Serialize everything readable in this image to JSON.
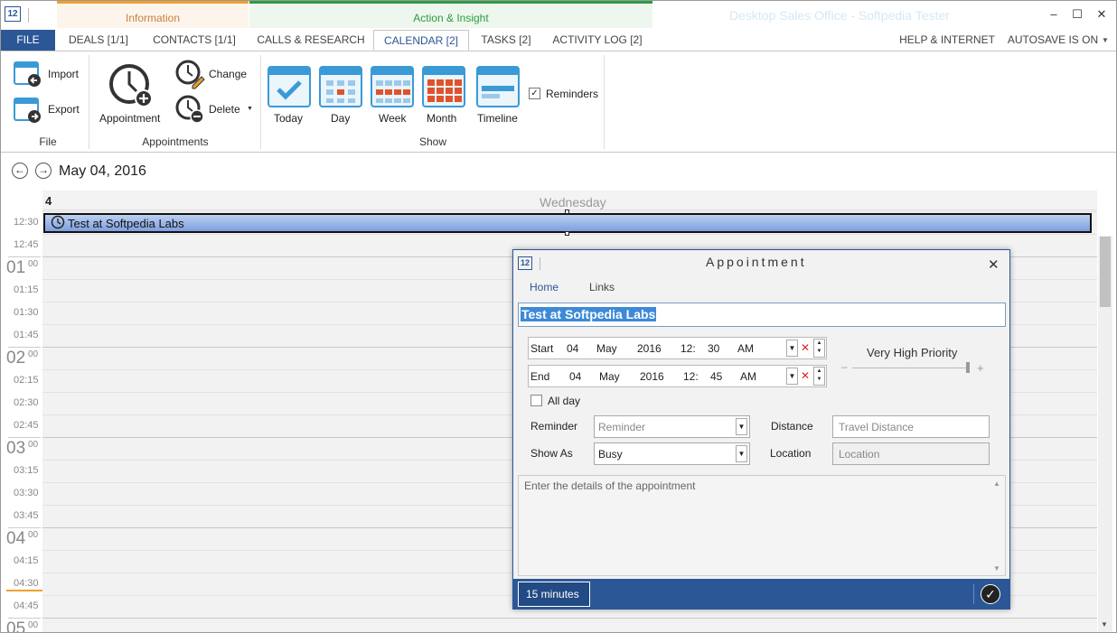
{
  "window": {
    "title": "Desktop Sales Office - Softpedia Tester",
    "logo": "12",
    "controls": {
      "minimize": "–",
      "maximize": "☐",
      "close": "✕"
    }
  },
  "ribbon_groups": {
    "information": "Information",
    "action": "Action & Insight"
  },
  "tabs": {
    "file": "FILE",
    "deals": "DEALS [1/1]",
    "contacts": "CONTACTS [1/1]",
    "calls": "CALLS & RESEARCH",
    "calendar": "CALENDAR [2]",
    "tasks": "TASKS [2]",
    "activity": "ACTIVITY LOG [2]",
    "help": "HELP & INTERNET",
    "autosave": "AUTOSAVE IS ON"
  },
  "ribbon": {
    "file": {
      "import": "Import",
      "export": "Export",
      "label": "File"
    },
    "appointments": {
      "appointment": "Appointment",
      "change": "Change",
      "delete": "Delete",
      "label": "Appointments"
    },
    "show": {
      "today": "Today",
      "day": "Day",
      "week": "Week",
      "month": "Month",
      "timeline": "Timeline",
      "reminders": "Reminders",
      "label": "Show"
    }
  },
  "calendar": {
    "date": "May 04, 2016",
    "day_number": "4",
    "day_name": "Wednesday",
    "times": [
      "12:30",
      "12:45",
      "01",
      "01:15",
      "01:30",
      "01:45",
      "02",
      "02:15",
      "02:30",
      "02:45",
      "03",
      "03:15",
      "03:30",
      "03:45",
      "04",
      "04:15",
      "04:30",
      "04:45",
      "05"
    ],
    "hour_suffix": "00",
    "event": {
      "title": "Test at Softpedia Labs"
    }
  },
  "dialog": {
    "title": "Appointment",
    "tabs": {
      "home": "Home",
      "links": "Links"
    },
    "subject": "Test at Softpedia Labs",
    "start": {
      "label": "Start",
      "day": "04",
      "month": "May",
      "year": "2016",
      "hour": "12:",
      "minute": "30",
      "ampm": "AM"
    },
    "end": {
      "label": "End",
      "day": "04",
      "month": "May",
      "year": "2016",
      "hour": "12:",
      "minute": "45",
      "ampm": "AM"
    },
    "priority": "Very High Priority",
    "all_day": "All day",
    "reminder": {
      "label": "Reminder",
      "placeholder": "Reminder"
    },
    "show_as": {
      "label": "Show As",
      "value": "Busy"
    },
    "distance": {
      "label": "Distance",
      "placeholder": "Travel Distance"
    },
    "location": {
      "label": "Location",
      "placeholder": "Location"
    },
    "details_placeholder": "Enter the details of the appointment",
    "duration": "15 minutes"
  }
}
